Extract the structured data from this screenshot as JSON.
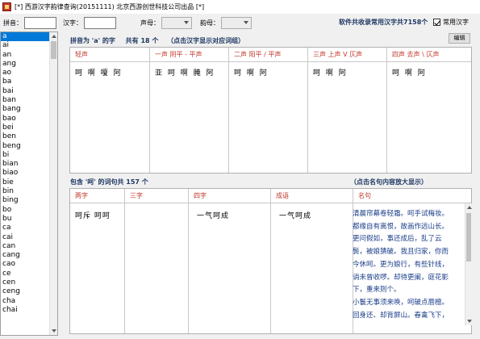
{
  "window": {
    "title": "[*] 西游汉字韵律查询(20151111) 北京西游创世科技公司出品 [*]"
  },
  "toolbar": {
    "pinyin_label": "拼音：",
    "hanzi_label": "汉字：",
    "tone_label": "声母：",
    "rhyme_label": "韵母：",
    "info_prefix": "软件共收录常用汉字共",
    "info_count": "7158",
    "info_suffix": "个",
    "common_label": "常用汉字"
  },
  "sidebar": {
    "items": [
      "a",
      "ai",
      "an",
      "ang",
      "ao",
      "ba",
      "bai",
      "ban",
      "bang",
      "bao",
      "bei",
      "ben",
      "beng",
      "bi",
      "bian",
      "biao",
      "bie",
      "bin",
      "bing",
      "bo",
      "bu",
      "ca",
      "cai",
      "can",
      "cang",
      "cao",
      "ce",
      "cen",
      "ceng",
      "cha",
      "chai"
    ]
  },
  "tones": {
    "title_prefix": "拼音为 'a' 的字",
    "title_count": "共有 18 个",
    "title_hint": "（点击汉字显示对应词组）",
    "edit_label": "编辑",
    "headers": [
      "轻声",
      "一声 阴平 - 平声",
      "二声 阳平 / 平声",
      "三声 上声 V 仄声",
      "四声 去声 \\ 仄声"
    ],
    "values": [
      "呵 啊 嗄 阿",
      "亚 呵 啊 腌 阿",
      "呵 啊 阿",
      "呵 啊 阿",
      "呵 啊 阿"
    ]
  },
  "phrases": {
    "title": "包含 '呵' 的词句共 157 个",
    "hint": "（点击名句内容放大显示）",
    "headers": [
      "两字",
      "三字",
      "四字",
      "成语",
      "名句"
    ],
    "two_char": "呵斥  呵呵",
    "three_char": "",
    "four_char": "一气呵成",
    "idiom": "一气呵成",
    "poem_lines": [
      "清晨帘幕卷轻霜。呵手试梅妆。",
      "都缘自有离恨，故画作远山长。",
      "更问假如，事还成后，乱了云",
      "鬓，被娘猜破。我且归家，你而",
      "今休呵。更为娘行，有些针线，",
      "诮未曾收啰。却待更阑，庭花影",
      "下，重来则个。",
      "小鬟无事须来唤，呵破点唇檀。",
      "回身还、却背屏山。春禽飞下，"
    ]
  }
}
